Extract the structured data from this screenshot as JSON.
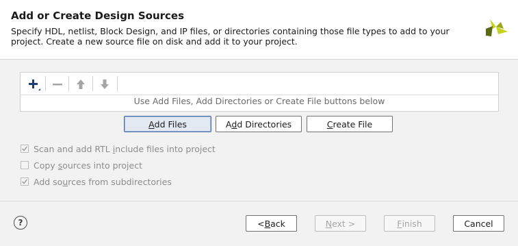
{
  "dialog": {
    "title": "Add or Create Design Sources",
    "description": "Specify HDL, netlist, Block Design, and IP files, or directories containing those file types to add to your project. Create a new source file on disk and add it to your project.",
    "logo_icon": "xilinx-logo-icon"
  },
  "files_panel": {
    "toolbar": [
      {
        "icon": "plus-icon",
        "enabled": true
      },
      {
        "icon": "minus-icon",
        "enabled": false
      },
      {
        "icon": "arrow-up-icon",
        "enabled": false
      },
      {
        "icon": "arrow-down-icon",
        "enabled": false
      }
    ],
    "empty_hint": "Use Add Files, Add Directories or Create File buttons below"
  },
  "add_buttons": {
    "add_files": {
      "pre": "",
      "mnemonic": "A",
      "post": "dd Files"
    },
    "add_directories": {
      "pre": "A",
      "mnemonic": "d",
      "post": "d Directories"
    },
    "create_file": {
      "pre": "",
      "mnemonic": "C",
      "post": "reate File"
    }
  },
  "options": [
    {
      "pre": "Scan and add RTL ",
      "mnemonic": "i",
      "post": "nclude files into project",
      "checked": true,
      "enabled": false
    },
    {
      "pre": "Copy ",
      "mnemonic": "s",
      "post": "ources into project",
      "checked": false,
      "enabled": false
    },
    {
      "pre": "Add so",
      "mnemonic": "u",
      "post": "rces from subdirectories",
      "checked": true,
      "enabled": false
    }
  ],
  "footer": {
    "help_glyph": "?",
    "back": {
      "pre": "< ",
      "mnemonic": "B",
      "post": "ack"
    },
    "next": {
      "pre": "",
      "mnemonic": "N",
      "post": "ext >"
    },
    "finish": {
      "pre": "",
      "mnemonic": "F",
      "post": "inish"
    },
    "cancel": "Cancel"
  },
  "colors": {
    "logo_dark": "#5a6a12",
    "logo_light": "#c7d21f",
    "plus_blue": "#1f3c78",
    "disabled_gray": "#a5a5a5"
  }
}
